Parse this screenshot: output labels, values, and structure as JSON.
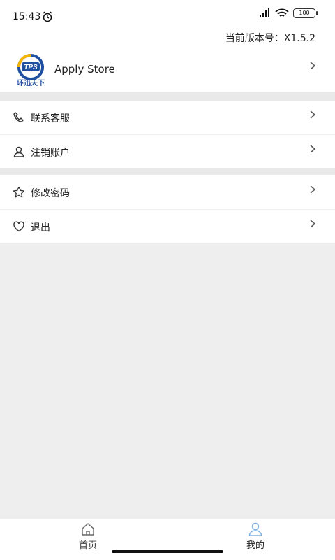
{
  "status_bar": {
    "time": "15:43",
    "battery": "100"
  },
  "header": {
    "version": "当前版本号：X1.5.2"
  },
  "app": {
    "name": "Apply Store",
    "logo_text": "TPS",
    "logo_caption": "环迅天下"
  },
  "menu": {
    "group1": [
      {
        "label": "联系客服",
        "icon": "phone-icon"
      },
      {
        "label": "注销账户",
        "icon": "user-icon"
      }
    ],
    "group2": [
      {
        "label": "修改密码",
        "icon": "star-icon"
      },
      {
        "label": "退出",
        "icon": "heart-icon"
      }
    ]
  },
  "bottom_nav": [
    {
      "label": "首页",
      "icon": "home-icon",
      "active": false
    },
    {
      "label": "我的",
      "icon": "profile-icon",
      "active": true
    }
  ],
  "colors": {
    "active": "#7fb0e0",
    "inactive": "#666666",
    "background": "#eeeeee"
  }
}
